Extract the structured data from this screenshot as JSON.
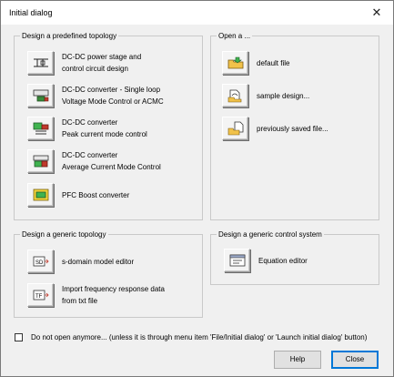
{
  "window": {
    "title": "Initial dialog",
    "close_glyph": "✕"
  },
  "predefined": {
    "label": "Design a predefined topology",
    "items": [
      {
        "icon": "power-stage-icon",
        "line1": "DC-DC power stage and",
        "line2": "control circuit design"
      },
      {
        "icon": "single-loop-converter-icon",
        "line1": "DC-DC converter - Single loop",
        "line2": "Voltage Mode Control or ACMC"
      },
      {
        "icon": "peak-current-converter-icon",
        "line1": "DC-DC converter",
        "line2": "Peak current mode control"
      },
      {
        "icon": "average-current-converter-icon",
        "line1": "DC-DC converter",
        "line2": "Average Current Mode Control"
      },
      {
        "icon": "pfc-boost-icon",
        "line1": "PFC Boost converter",
        "line2": ""
      }
    ]
  },
  "open": {
    "label": "Open a ...",
    "items": [
      {
        "icon": "open-folder-icon",
        "text": "default file"
      },
      {
        "icon": "sample-design-icon",
        "text": "sample design..."
      },
      {
        "icon": "saved-file-icon",
        "text": "previously saved file..."
      }
    ]
  },
  "generic_topology": {
    "label": "Design a generic topology",
    "items": [
      {
        "icon": "s-domain-editor-icon",
        "line1": "s-domain model editor",
        "line2": ""
      },
      {
        "icon": "frequency-import-icon",
        "line1": "Import frequency response data",
        "line2": "from txt file"
      }
    ]
  },
  "generic_control": {
    "label": "Design a generic control system",
    "items": [
      {
        "icon": "equation-editor-icon",
        "text": "Equation editor"
      }
    ]
  },
  "footer": {
    "checkbox_label": "Do not open anymore... (unless it is through menu item 'File/Initial dialog' or 'Launch initial dialog' button)",
    "checked": false,
    "help_label": "Help",
    "close_label": "Close"
  }
}
